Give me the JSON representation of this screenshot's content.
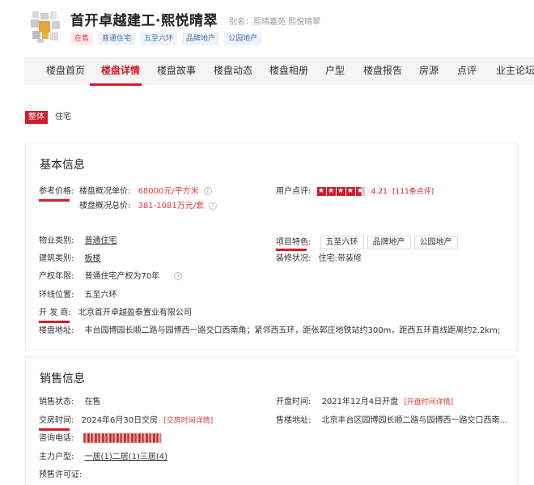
{
  "header": {
    "title": "首开卓越建工·熙悦晴翠",
    "alias": "别名：熙晴嘉苑 熙悦晴翠",
    "tags": [
      "在售",
      "普通住宅",
      "五至六环",
      "品牌地产",
      "公园地产"
    ]
  },
  "nav": {
    "items": [
      "楼盘首页",
      "楼盘详情",
      "楼盘故事",
      "楼盘动态",
      "楼盘相册",
      "户型",
      "楼盘报告",
      "房源",
      "点评",
      "业主论坛"
    ],
    "active": "楼盘详情"
  },
  "type_filter": {
    "badge": "整体",
    "text": "住宅"
  },
  "basic": {
    "title": "基本信息",
    "price_label": "参考价格:",
    "unit_price_label": "楼盘概况单价:",
    "unit_price": "68000元/平方米",
    "total_price_label": "楼盘概况总价:",
    "total_price": "381-1081万元/套",
    "review_label": "用户点评:",
    "rating_score": "4.21",
    "rating_count": "[111条点评]",
    "rating_stars": 4.21,
    "property_type_label": "物业类别:",
    "property_type": "普通住宅",
    "features_label": "项目特色:",
    "features": [
      "五至六环",
      "品牌地产",
      "公园地产"
    ],
    "building_type_label": "建筑类别:",
    "building_type": "板楼",
    "decoration_label": "装修状况:",
    "decoration": "住宅:带装修",
    "rights_label": "产权年限:",
    "rights": "普通住宅产权为70年",
    "ring_label": "环线位置:",
    "ring": "五至六环",
    "developer_label": "开 发 商:",
    "developer": "北京首开卓越盈泰置业有限公司",
    "address_label": "楼盘地址:",
    "address": "丰台园博园长顺二路与园博西一路交口西南角；紧邻西五环，距张郭庄地铁站约300m，距西五环直线距离约2.2km;"
  },
  "sales": {
    "title": "销售信息",
    "status_label": "销售状态:",
    "status": "在售",
    "open_label": "开盘时间:",
    "open_date": "2021年12月4日开盘",
    "open_detail": "[开盘时间详情]",
    "delivery_label": "交房时间:",
    "delivery_date": "2024年6月30日交房",
    "delivery_detail": "[交房时间详情]",
    "sales_address_label": "售楼地址:",
    "sales_address": "北京丰台区园博园长顺二路与园博西一路交口西南...",
    "phone_label": "咨询电话:",
    "layout_label": "主力户型:",
    "layouts": [
      "一居(1)",
      "二居(1)",
      "三居(4)"
    ],
    "permit_label": "预售许可证:"
  },
  "colors": {
    "accent": "#d11e2d",
    "price": "#e03b3b",
    "nav_bg": "#f5f5f5"
  }
}
